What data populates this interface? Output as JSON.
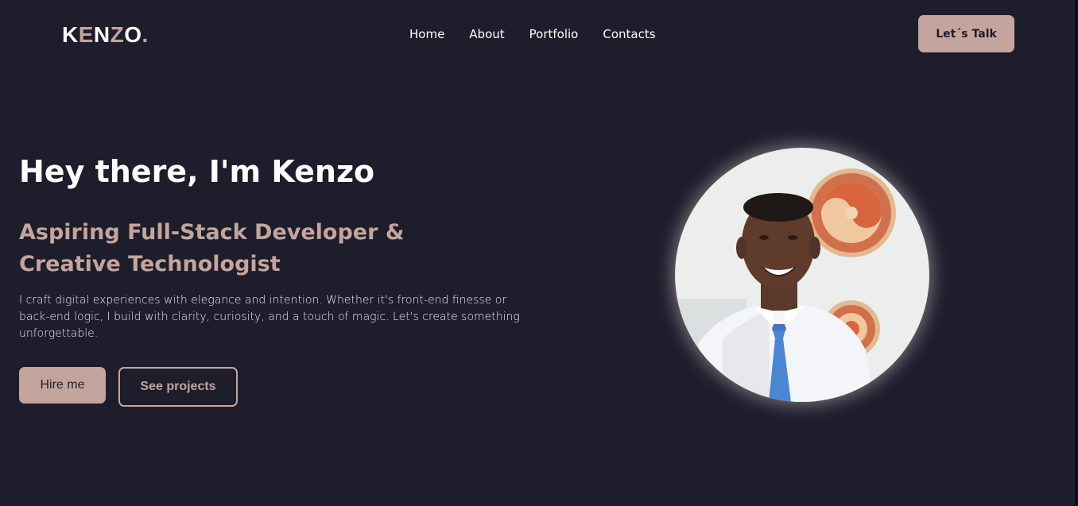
{
  "nav": {
    "logo": {
      "letters": [
        "K",
        "E",
        "N",
        "Z",
        "O",
        "."
      ]
    },
    "links": [
      "Home",
      "About",
      "Portfolio",
      "Contacts"
    ],
    "cta_label": "Let´s Talk"
  },
  "hero": {
    "title": "Hey there, I'm Kenzo",
    "subtitle": "Aspiring Full-Stack Developer & Creative Technologist",
    "description": "I craft digital experiences with elegance and intention. Whether it's front-end finesse or back-end logic, I build with clarity, curiosity, and a touch of magic. Let's create something unforgettable.",
    "primary_button": "Hire me",
    "secondary_button": "See projects"
  },
  "theme": {
    "background": "#1d1d2c",
    "accent": "#c4a59d",
    "text": "#ffffff"
  }
}
